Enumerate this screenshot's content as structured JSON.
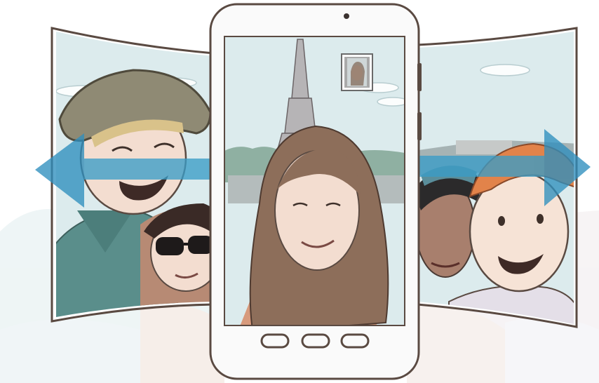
{
  "colors": {
    "sky": "#dcebed",
    "cloud": "#fbfdfd",
    "trees": "#8fb0a2",
    "tower": "#b6b4b6",
    "skin": "#f3ddd0",
    "hair_brown": "#8d6e5a",
    "hat": "#8f8a74",
    "shirt_teal": "#5a8e8b",
    "arrow": "#3a9cc6",
    "phone_frame": "#fafafa",
    "outline": "#5a4a42"
  },
  "icons": {
    "left_arrow": "arrow-left-icon",
    "right_arrow": "arrow-right-icon",
    "camera": "front-camera-icon",
    "buttons": [
      "recent-apps-button",
      "home-button",
      "back-button"
    ]
  }
}
